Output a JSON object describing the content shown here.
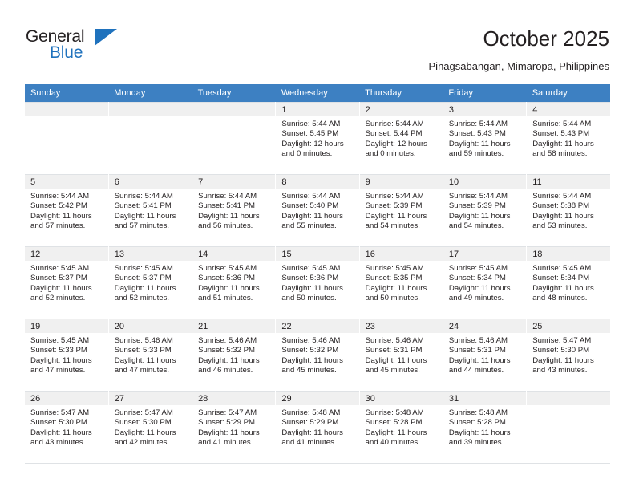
{
  "brand": {
    "name_top": "General",
    "name_bottom": "Blue",
    "triangle_color": "#1f72bd"
  },
  "header": {
    "title": "October 2025",
    "subtitle": "Pinagsabangan, Mimaropa, Philippines",
    "accent_color": "#3d80c2"
  },
  "weekdays": [
    "Sunday",
    "Monday",
    "Tuesday",
    "Wednesday",
    "Thursday",
    "Friday",
    "Saturday"
  ],
  "weeks": [
    [
      {
        "day": "",
        "sunrise": "",
        "sunset": "",
        "daylight_line1": "",
        "daylight_line2": "",
        "empty": true
      },
      {
        "day": "",
        "sunrise": "",
        "sunset": "",
        "daylight_line1": "",
        "daylight_line2": "",
        "empty": true
      },
      {
        "day": "",
        "sunrise": "",
        "sunset": "",
        "daylight_line1": "",
        "daylight_line2": "",
        "empty": true
      },
      {
        "day": "1",
        "sunrise": "Sunrise: 5:44 AM",
        "sunset": "Sunset: 5:45 PM",
        "daylight_line1": "Daylight: 12 hours",
        "daylight_line2": "and 0 minutes."
      },
      {
        "day": "2",
        "sunrise": "Sunrise: 5:44 AM",
        "sunset": "Sunset: 5:44 PM",
        "daylight_line1": "Daylight: 12 hours",
        "daylight_line2": "and 0 minutes."
      },
      {
        "day": "3",
        "sunrise": "Sunrise: 5:44 AM",
        "sunset": "Sunset: 5:43 PM",
        "daylight_line1": "Daylight: 11 hours",
        "daylight_line2": "and 59 minutes."
      },
      {
        "day": "4",
        "sunrise": "Sunrise: 5:44 AM",
        "sunset": "Sunset: 5:43 PM",
        "daylight_line1": "Daylight: 11 hours",
        "daylight_line2": "and 58 minutes."
      }
    ],
    [
      {
        "day": "5",
        "sunrise": "Sunrise: 5:44 AM",
        "sunset": "Sunset: 5:42 PM",
        "daylight_line1": "Daylight: 11 hours",
        "daylight_line2": "and 57 minutes."
      },
      {
        "day": "6",
        "sunrise": "Sunrise: 5:44 AM",
        "sunset": "Sunset: 5:41 PM",
        "daylight_line1": "Daylight: 11 hours",
        "daylight_line2": "and 57 minutes."
      },
      {
        "day": "7",
        "sunrise": "Sunrise: 5:44 AM",
        "sunset": "Sunset: 5:41 PM",
        "daylight_line1": "Daylight: 11 hours",
        "daylight_line2": "and 56 minutes."
      },
      {
        "day": "8",
        "sunrise": "Sunrise: 5:44 AM",
        "sunset": "Sunset: 5:40 PM",
        "daylight_line1": "Daylight: 11 hours",
        "daylight_line2": "and 55 minutes."
      },
      {
        "day": "9",
        "sunrise": "Sunrise: 5:44 AM",
        "sunset": "Sunset: 5:39 PM",
        "daylight_line1": "Daylight: 11 hours",
        "daylight_line2": "and 54 minutes."
      },
      {
        "day": "10",
        "sunrise": "Sunrise: 5:44 AM",
        "sunset": "Sunset: 5:39 PM",
        "daylight_line1": "Daylight: 11 hours",
        "daylight_line2": "and 54 minutes."
      },
      {
        "day": "11",
        "sunrise": "Sunrise: 5:44 AM",
        "sunset": "Sunset: 5:38 PM",
        "daylight_line1": "Daylight: 11 hours",
        "daylight_line2": "and 53 minutes."
      }
    ],
    [
      {
        "day": "12",
        "sunrise": "Sunrise: 5:45 AM",
        "sunset": "Sunset: 5:37 PM",
        "daylight_line1": "Daylight: 11 hours",
        "daylight_line2": "and 52 minutes."
      },
      {
        "day": "13",
        "sunrise": "Sunrise: 5:45 AM",
        "sunset": "Sunset: 5:37 PM",
        "daylight_line1": "Daylight: 11 hours",
        "daylight_line2": "and 52 minutes."
      },
      {
        "day": "14",
        "sunrise": "Sunrise: 5:45 AM",
        "sunset": "Sunset: 5:36 PM",
        "daylight_line1": "Daylight: 11 hours",
        "daylight_line2": "and 51 minutes."
      },
      {
        "day": "15",
        "sunrise": "Sunrise: 5:45 AM",
        "sunset": "Sunset: 5:36 PM",
        "daylight_line1": "Daylight: 11 hours",
        "daylight_line2": "and 50 minutes."
      },
      {
        "day": "16",
        "sunrise": "Sunrise: 5:45 AM",
        "sunset": "Sunset: 5:35 PM",
        "daylight_line1": "Daylight: 11 hours",
        "daylight_line2": "and 50 minutes."
      },
      {
        "day": "17",
        "sunrise": "Sunrise: 5:45 AM",
        "sunset": "Sunset: 5:34 PM",
        "daylight_line1": "Daylight: 11 hours",
        "daylight_line2": "and 49 minutes."
      },
      {
        "day": "18",
        "sunrise": "Sunrise: 5:45 AM",
        "sunset": "Sunset: 5:34 PM",
        "daylight_line1": "Daylight: 11 hours",
        "daylight_line2": "and 48 minutes."
      }
    ],
    [
      {
        "day": "19",
        "sunrise": "Sunrise: 5:45 AM",
        "sunset": "Sunset: 5:33 PM",
        "daylight_line1": "Daylight: 11 hours",
        "daylight_line2": "and 47 minutes."
      },
      {
        "day": "20",
        "sunrise": "Sunrise: 5:46 AM",
        "sunset": "Sunset: 5:33 PM",
        "daylight_line1": "Daylight: 11 hours",
        "daylight_line2": "and 47 minutes."
      },
      {
        "day": "21",
        "sunrise": "Sunrise: 5:46 AM",
        "sunset": "Sunset: 5:32 PM",
        "daylight_line1": "Daylight: 11 hours",
        "daylight_line2": "and 46 minutes."
      },
      {
        "day": "22",
        "sunrise": "Sunrise: 5:46 AM",
        "sunset": "Sunset: 5:32 PM",
        "daylight_line1": "Daylight: 11 hours",
        "daylight_line2": "and 45 minutes."
      },
      {
        "day": "23",
        "sunrise": "Sunrise: 5:46 AM",
        "sunset": "Sunset: 5:31 PM",
        "daylight_line1": "Daylight: 11 hours",
        "daylight_line2": "and 45 minutes."
      },
      {
        "day": "24",
        "sunrise": "Sunrise: 5:46 AM",
        "sunset": "Sunset: 5:31 PM",
        "daylight_line1": "Daylight: 11 hours",
        "daylight_line2": "and 44 minutes."
      },
      {
        "day": "25",
        "sunrise": "Sunrise: 5:47 AM",
        "sunset": "Sunset: 5:30 PM",
        "daylight_line1": "Daylight: 11 hours",
        "daylight_line2": "and 43 minutes."
      }
    ],
    [
      {
        "day": "26",
        "sunrise": "Sunrise: 5:47 AM",
        "sunset": "Sunset: 5:30 PM",
        "daylight_line1": "Daylight: 11 hours",
        "daylight_line2": "and 43 minutes."
      },
      {
        "day": "27",
        "sunrise": "Sunrise: 5:47 AM",
        "sunset": "Sunset: 5:30 PM",
        "daylight_line1": "Daylight: 11 hours",
        "daylight_line2": "and 42 minutes."
      },
      {
        "day": "28",
        "sunrise": "Sunrise: 5:47 AM",
        "sunset": "Sunset: 5:29 PM",
        "daylight_line1": "Daylight: 11 hours",
        "daylight_line2": "and 41 minutes."
      },
      {
        "day": "29",
        "sunrise": "Sunrise: 5:48 AM",
        "sunset": "Sunset: 5:29 PM",
        "daylight_line1": "Daylight: 11 hours",
        "daylight_line2": "and 41 minutes."
      },
      {
        "day": "30",
        "sunrise": "Sunrise: 5:48 AM",
        "sunset": "Sunset: 5:28 PM",
        "daylight_line1": "Daylight: 11 hours",
        "daylight_line2": "and 40 minutes."
      },
      {
        "day": "31",
        "sunrise": "Sunrise: 5:48 AM",
        "sunset": "Sunset: 5:28 PM",
        "daylight_line1": "Daylight: 11 hours",
        "daylight_line2": "and 39 minutes."
      },
      {
        "day": "",
        "sunrise": "",
        "sunset": "",
        "daylight_line1": "",
        "daylight_line2": "",
        "empty": true
      }
    ]
  ]
}
